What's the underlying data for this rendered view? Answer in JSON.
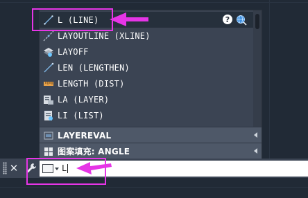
{
  "autocomplete": {
    "items": [
      {
        "label": "L (LINE)",
        "icon": "line-icon"
      },
      {
        "label": "LAYOUTLINE (XLINE)",
        "icon": "xline-icon"
      },
      {
        "label": "LAYOFF",
        "icon": "layoff-icon"
      },
      {
        "label": "LEN (LENGTHEN)",
        "icon": "lengthen-icon"
      },
      {
        "label": "LENGTH (DIST)",
        "icon": "measure-icon"
      },
      {
        "label": "LA (LAYER)",
        "icon": "layer-icon"
      },
      {
        "label": "LI (LIST)",
        "icon": "list-icon"
      }
    ],
    "sections": [
      {
        "label": "LAYEREVAL",
        "icon": "layereval-icon"
      },
      {
        "label": "图案填充: ANGLE",
        "icon": "hatch-icon"
      }
    ],
    "help_icon": "?"
  },
  "command_line": {
    "input_value": "L"
  },
  "colors": {
    "highlight": "#e635e6",
    "popup_bg": "#3b4453",
    "section_bg": "#4e5868"
  }
}
